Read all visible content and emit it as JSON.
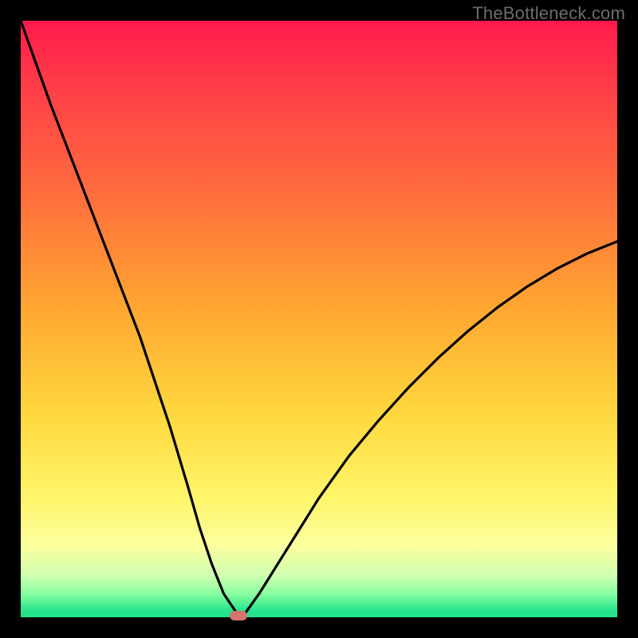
{
  "watermark": "TheBottleneck.com",
  "chart_data": {
    "type": "line",
    "title": "",
    "xlabel": "",
    "ylabel": "",
    "xlim": [
      0,
      100
    ],
    "ylim": [
      0,
      100
    ],
    "grid": false,
    "legend": false,
    "series": [
      {
        "name": "bottleneck-curve",
        "x": [
          0,
          5,
          10,
          15,
          20,
          25,
          28,
          30,
          32,
          34,
          36,
          37,
          37.5,
          40,
          45,
          50,
          55,
          60,
          65,
          70,
          75,
          80,
          85,
          90,
          95,
          100
        ],
        "y": [
          100,
          86,
          73,
          60,
          47,
          32,
          22,
          15,
          9,
          4,
          1,
          0,
          0.5,
          4,
          12,
          20,
          27,
          33,
          38.5,
          43.5,
          48,
          52,
          55.5,
          58.5,
          61,
          63
        ]
      }
    ],
    "annotations": [
      {
        "name": "optimal-marker",
        "x": 36.5,
        "y": 0
      }
    ],
    "background_gradient": {
      "top": "#ff1a4d",
      "bottom": "#22e28a"
    }
  }
}
